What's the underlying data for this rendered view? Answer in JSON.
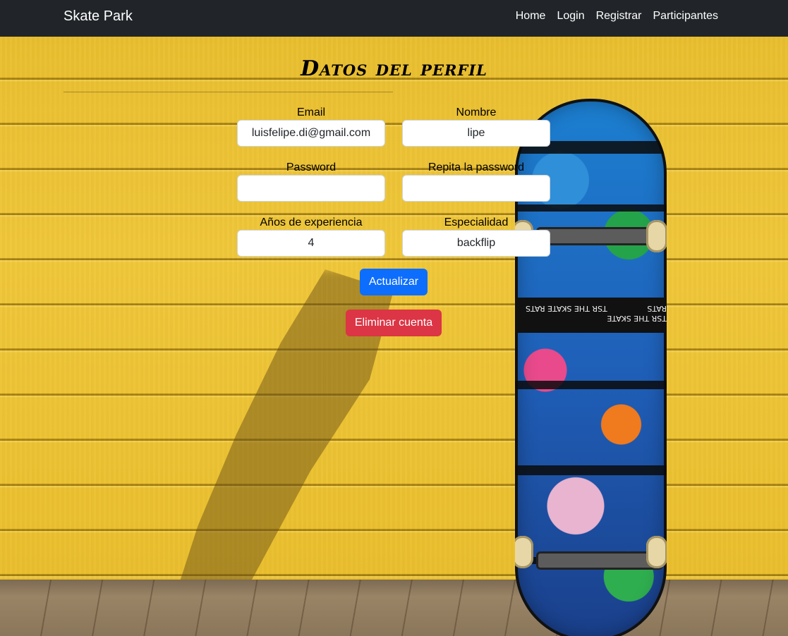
{
  "navbar": {
    "brand": "Skate Park",
    "links": [
      {
        "label": "Home"
      },
      {
        "label": "Login"
      },
      {
        "label": "Registrar"
      },
      {
        "label": "Participantes"
      }
    ]
  },
  "page": {
    "title": "Datos del perfil"
  },
  "form": {
    "email": {
      "label": "Email",
      "value": "luisfelipe.di@gmail.com"
    },
    "nombre": {
      "label": "Nombre",
      "value": "lipe"
    },
    "password": {
      "label": "Password",
      "value": ""
    },
    "repita_password": {
      "label": "Repita la password",
      "value": ""
    },
    "experiencia": {
      "label": "Años de experiencia",
      "value": "4"
    },
    "especialidad": {
      "label": "Especialidad",
      "value": "backflip"
    },
    "update_button": "Actualizar",
    "delete_button": "Eliminar cuenta"
  },
  "background": {
    "skateboard_labels": [
      "TSR THE SKATE RATS",
      "TSR THE SKATE RATS"
    ]
  },
  "colors": {
    "navbar": "#212529",
    "wall": "#EEC437",
    "primary": "#0d6efd",
    "danger": "#dc3545"
  }
}
